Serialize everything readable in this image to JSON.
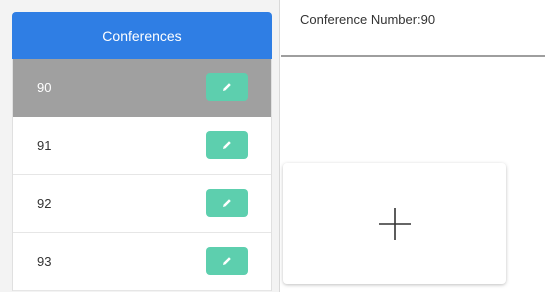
{
  "sidebar": {
    "header_label": "Conferences",
    "items": [
      {
        "label": "90",
        "selected": true
      },
      {
        "label": "91",
        "selected": false
      },
      {
        "label": "92",
        "selected": false
      },
      {
        "label": "93",
        "selected": false
      }
    ]
  },
  "detail": {
    "conference_number_label": "Conference Number:90"
  },
  "icons": {
    "edit": "pencil-icon",
    "add": "plus-icon"
  },
  "colors": {
    "header_blue": "#2f7ee4",
    "edit_button_green": "#5dcfae",
    "selected_row_gray": "#a0a0a0"
  }
}
